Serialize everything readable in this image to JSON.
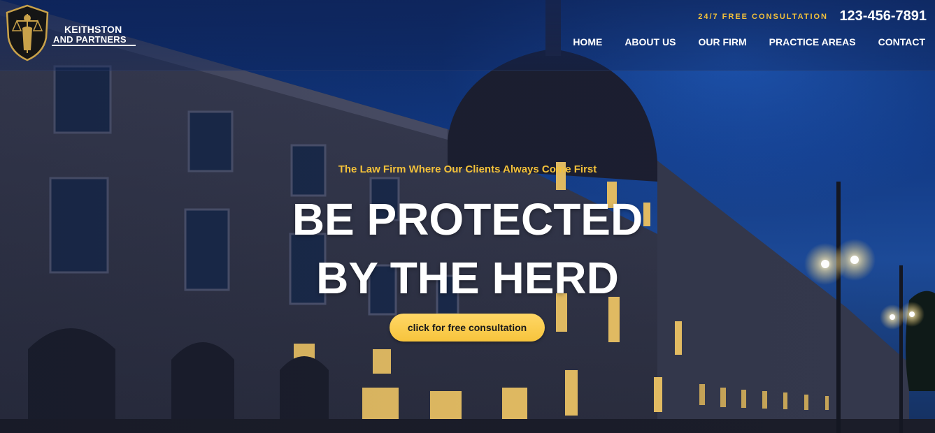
{
  "brand": {
    "name_line1": "KEITHSTON",
    "name_line2": "AND PARTNERS"
  },
  "header": {
    "consultation_label": "24/7 FREE CONSULTATION",
    "phone": "123-456-7891"
  },
  "nav": {
    "items": [
      {
        "label": "HOME"
      },
      {
        "label": "ABOUT US"
      },
      {
        "label": "OUR FIRM"
      },
      {
        "label": "PRACTICE AREAS"
      },
      {
        "label": "CONTACT"
      }
    ]
  },
  "hero": {
    "tagline": "The Law Firm Where Our Clients Always Come First",
    "headline_line1": "BE PROTECTED",
    "headline_line2": "BY THE HERD",
    "cta_label": "click for free consultation"
  },
  "colors": {
    "accent": "#f3c13a",
    "sky": "#123a86",
    "text": "#ffffff"
  },
  "icons": {
    "logo": "lady-justice-shield-icon"
  }
}
